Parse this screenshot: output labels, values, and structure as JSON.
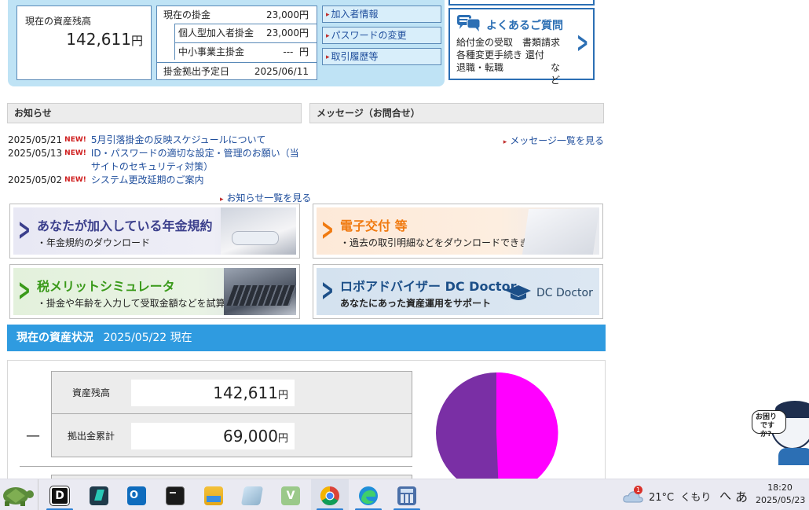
{
  "balance": {
    "label": "現在の資産残高",
    "value": "142,611",
    "unit": "円"
  },
  "contrib": {
    "rows": [
      {
        "label": "現在の掛金",
        "value": "23,000円"
      },
      {
        "label": "個人型加入者掛金",
        "value": "23,000円"
      },
      {
        "label": "中小事業主掛金",
        "value": "---  円"
      },
      {
        "label": "掛金拠出予定日",
        "value": "2025/06/11"
      }
    ]
  },
  "quicklinks": [
    "加入者情報",
    "パスワードの変更",
    "取引履歴等"
  ],
  "faq": {
    "title": "よくあるご質問",
    "lines": [
      "給付金の受取　書類請求",
      "各種変更手続き 還付",
      "退職・転職"
    ],
    "suffix": "など"
  },
  "news": {
    "header": "お知らせ",
    "badge": "NEW!",
    "items": [
      {
        "date": "2025/05/21",
        "text": "5月引落掛金の反映スケジュールについて"
      },
      {
        "date": "2025/05/13",
        "text": "ID・パスワードの適切な設定・管理のお願い（当サイトのセキュリティ対策）"
      },
      {
        "date": "2025/05/02",
        "text": "システム更改延期のご案内"
      }
    ],
    "more": "お知らせ一覧を見る"
  },
  "messages": {
    "header": "メッセージ（お問合せ）",
    "more": "メッセージ一覧を見る"
  },
  "banners": [
    {
      "title": "あなたが加入している年金規約",
      "sub": "・年金規約のダウンロード"
    },
    {
      "title": "電子交付 等",
      "sub": "・過去の取引明細などをダウンロードできます"
    },
    {
      "title": "税メリットシミュレータ",
      "sub": "・掛金や年齢を入力して受取金額などを試算"
    },
    {
      "title": "ロボアドバイザー DC Doctor",
      "sub": "あなたにあった資産運用をサポート",
      "logo": "DC Doctor"
    }
  ],
  "assets": {
    "title": "現在の資産状況",
    "date": "2025/05/22 現在",
    "rows": [
      {
        "label": "資産残高",
        "value": "142,611",
        "unit": "円"
      },
      {
        "label": "拠出金累計",
        "value": "69,000",
        "unit": "円"
      }
    ],
    "dash": "—",
    "pie_colors": [
      "#ff00ff",
      "#7a2fa5"
    ]
  },
  "helper": {
    "text1": "お困り",
    "text2": "ですか?"
  },
  "taskbar": {
    "weather": "21°C  くもり",
    "weather_badge": "1",
    "chevron": "へ",
    "ime": "あ",
    "time": "18:20",
    "date": "2025/05/23"
  }
}
